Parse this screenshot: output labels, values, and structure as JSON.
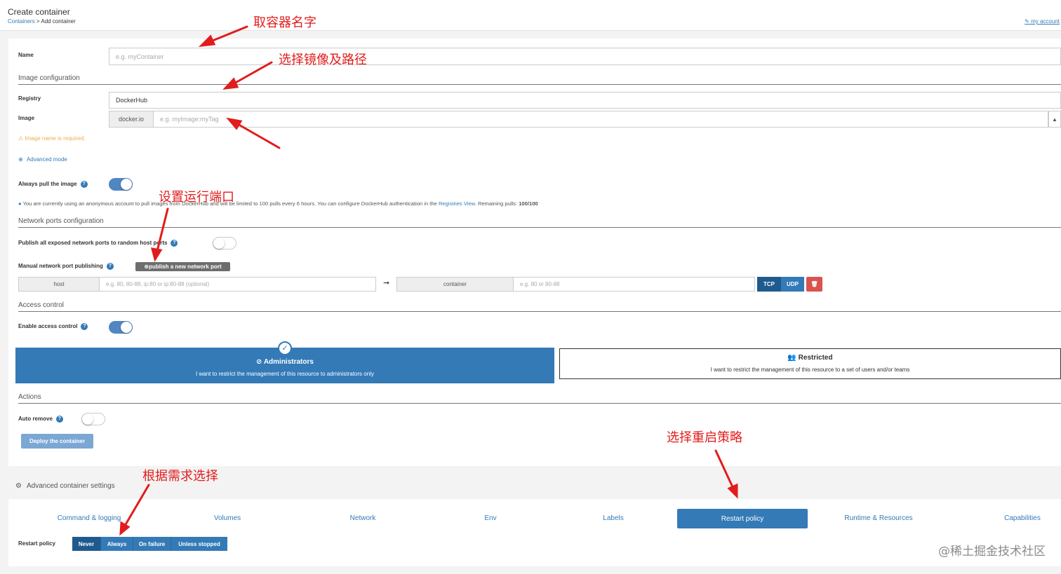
{
  "header": {
    "title": "Create container",
    "breadcrumb_link": "Containers",
    "breadcrumb_current": "> Add container",
    "account": "my account"
  },
  "name_field": {
    "label": "Name",
    "placeholder": "e.g. myContainer"
  },
  "image_config": {
    "section_title": "Image configuration",
    "registry_label": "Registry",
    "registry_value": "DockerHub",
    "image_label": "Image",
    "image_prefix": "docker.io",
    "image_placeholder": "e.g. myImage:myTag",
    "image_error": "Image name is required.",
    "advanced_mode": "Advanced mode",
    "always_pull_label": "Always pull the image",
    "always_pull_on": true,
    "info_text_1": "You are currently using an anonymous account to pull images from DockerHub and will be limited to 100 pulls every 6 hours. You can configure DockerHub authentication in the ",
    "info_link": "Registries View",
    "info_text_2": ". Remaining pulls: ",
    "info_remaining": "100/100"
  },
  "ports": {
    "section_title": "Network ports configuration",
    "publish_all_label": "Publish all exposed network ports to random host ports",
    "manual_label": "Manual network port publishing",
    "publish_button": "publish a new network port",
    "host_label": "host",
    "host_placeholder": "e.g. 80, 80-88, ip:80 or ip:80-88 (optional)",
    "container_label": "container",
    "container_placeholder": "e.g. 80 or 80-88",
    "tcp": "TCP",
    "udp": "UDP"
  },
  "access": {
    "section_title": "Access control",
    "enable_label": "Enable access control",
    "admin_title": "Administrators",
    "admin_desc": "I want to restrict the management of this resource to administrators only",
    "restricted_title": "Restricted",
    "restricted_desc": "I want to restrict the management of this resource to a set of users and/or teams"
  },
  "actions": {
    "section_title": "Actions",
    "auto_remove_label": "Auto remove",
    "deploy_button": "Deploy the container"
  },
  "advanced": {
    "title": "Advanced container settings",
    "tabs": [
      "Command & logging",
      "Volumes",
      "Network",
      "Env",
      "Labels",
      "Restart policy",
      "Runtime & Resources",
      "Capabilities"
    ],
    "active_tab": "Restart policy",
    "restart_label": "Restart policy",
    "restart_options": [
      "Never",
      "Always",
      "On failure",
      "Unless stopped"
    ],
    "restart_selected": "Never"
  },
  "annotations": {
    "name": "取容器名字",
    "image": "选择镜像及路径",
    "ports": "设置运行端口",
    "restart": "选择重启策略",
    "need": "根据需求选择"
  },
  "watermark": "@稀土掘金技术社区",
  "colors": {
    "primary": "#337ab7",
    "annotation": "#e21c1c",
    "danger": "#d9534f",
    "warning": "#f0ad4e"
  }
}
